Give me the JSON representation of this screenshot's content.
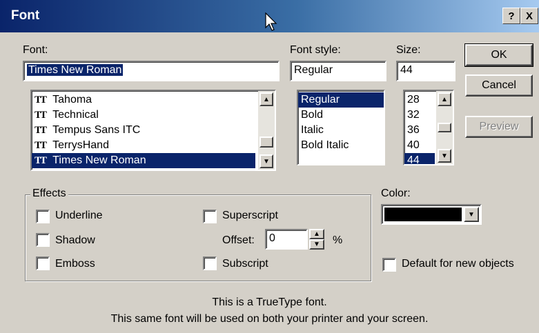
{
  "window": {
    "title": "Font",
    "help_btn": "?",
    "close_btn": "X"
  },
  "font": {
    "label": "Font:",
    "value": "Times New Roman",
    "list": [
      "Tahoma",
      "Technical",
      "Tempus Sans ITC",
      "TerrysHand",
      "Times New Roman"
    ],
    "selected_index": 4
  },
  "style": {
    "label": "Font style:",
    "value": "Regular",
    "list": [
      "Regular",
      "Bold",
      "Italic",
      "Bold Italic"
    ],
    "selected_index": 0
  },
  "size": {
    "label": "Size:",
    "value": "44",
    "list": [
      "28",
      "32",
      "36",
      "40",
      "44"
    ],
    "selected_index": 4
  },
  "buttons": {
    "ok": "OK",
    "cancel": "Cancel",
    "preview": "Preview"
  },
  "effects": {
    "label": "Effects",
    "underline": "Underline",
    "shadow": "Shadow",
    "emboss": "Emboss",
    "superscript": "Superscript",
    "subscript": "Subscript",
    "offset_label": "Offset:",
    "offset_value": "0",
    "offset_unit": "%"
  },
  "color": {
    "label": "Color:",
    "value_hex": "#000000"
  },
  "default_new": "Default for new objects",
  "message": {
    "line1": "This is a TrueType font.",
    "line2": "This same font will be used on both your printer and your screen."
  }
}
